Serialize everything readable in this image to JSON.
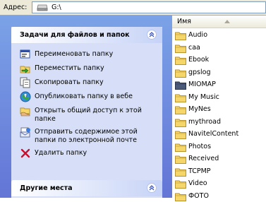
{
  "address_bar": {
    "label": "Адрес:",
    "value": "G:\\"
  },
  "tasks_panel": {
    "title": "Задачи для файлов и папок",
    "items": [
      {
        "label": "Переименовать папку",
        "icon": "rename-icon"
      },
      {
        "label": "Переместить папку",
        "icon": "move-icon"
      },
      {
        "label": "Скопировать папку",
        "icon": "copy-icon"
      },
      {
        "label": "Опубликовать папку в вебе",
        "icon": "publish-web-icon"
      },
      {
        "label": "Открыть общий доступ к этой папке",
        "icon": "share-icon"
      },
      {
        "label": "Отправить содержимое этой папки по электронной почте",
        "icon": "email-icon"
      },
      {
        "label": "Удалить папку",
        "icon": "delete-icon"
      }
    ]
  },
  "other_places_panel": {
    "title": "Другие места"
  },
  "file_list": {
    "column_header": "Имя",
    "selected": "MIOMAP",
    "items": [
      "Audio",
      "caa",
      "Ebook",
      "gpslog",
      "MIOMAP",
      "My Music",
      "MyNes",
      "mythroad",
      "NavitelContent",
      "Photos",
      "Received",
      "TCPMP",
      "Video",
      "ФОТО"
    ]
  },
  "colors": {
    "pane_top": "#7BA2E7",
    "pane_bottom": "#6375D6",
    "panel_bg": "#D6DFF7",
    "folder": "#F4D66A"
  }
}
